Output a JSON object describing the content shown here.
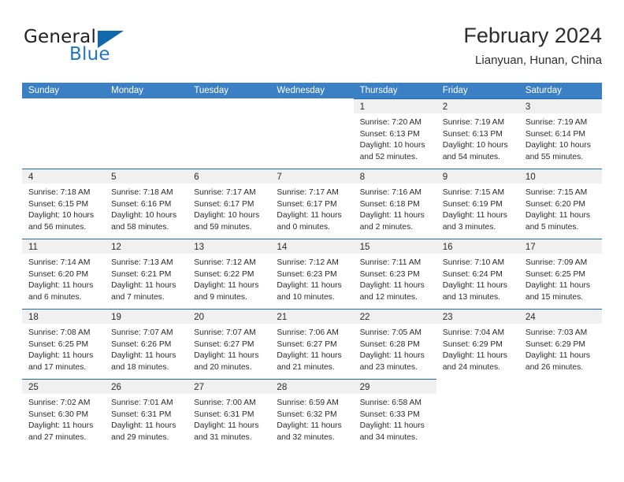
{
  "logo": {
    "word_top": "General",
    "word_bottom": "Blue",
    "flag_icon": "triangle-flag-icon",
    "color_blue": "#1f76c2",
    "color_dark": "#231f20"
  },
  "header": {
    "title": "February 2024",
    "subtitle": "Lianyuan, Hunan, China"
  },
  "calendar": {
    "header_bg": "#3b7fc4",
    "weekdays": [
      "Sunday",
      "Monday",
      "Tuesday",
      "Wednesday",
      "Thursday",
      "Friday",
      "Saturday"
    ],
    "weeks": [
      [
        {
          "day": "",
          "state": "empty",
          "lines": []
        },
        {
          "day": "",
          "state": "empty",
          "lines": []
        },
        {
          "day": "",
          "state": "empty",
          "lines": []
        },
        {
          "day": "",
          "state": "empty",
          "lines": []
        },
        {
          "day": "1",
          "state": "filled",
          "lines": [
            "Sunrise: 7:20 AM",
            "Sunset: 6:13 PM",
            "Daylight: 10 hours",
            "and 52 minutes."
          ]
        },
        {
          "day": "2",
          "state": "filled",
          "lines": [
            "Sunrise: 7:19 AM",
            "Sunset: 6:13 PM",
            "Daylight: 10 hours",
            "and 54 minutes."
          ]
        },
        {
          "day": "3",
          "state": "filled",
          "lines": [
            "Sunrise: 7:19 AM",
            "Sunset: 6:14 PM",
            "Daylight: 10 hours",
            "and 55 minutes."
          ]
        }
      ],
      [
        {
          "day": "4",
          "state": "filled",
          "lines": [
            "Sunrise: 7:18 AM",
            "Sunset: 6:15 PM",
            "Daylight: 10 hours",
            "and 56 minutes."
          ]
        },
        {
          "day": "5",
          "state": "filled",
          "lines": [
            "Sunrise: 7:18 AM",
            "Sunset: 6:16 PM",
            "Daylight: 10 hours",
            "and 58 minutes."
          ]
        },
        {
          "day": "6",
          "state": "filled",
          "lines": [
            "Sunrise: 7:17 AM",
            "Sunset: 6:17 PM",
            "Daylight: 10 hours",
            "and 59 minutes."
          ]
        },
        {
          "day": "7",
          "state": "filled",
          "lines": [
            "Sunrise: 7:17 AM",
            "Sunset: 6:17 PM",
            "Daylight: 11 hours",
            "and 0 minutes."
          ]
        },
        {
          "day": "8",
          "state": "filled",
          "lines": [
            "Sunrise: 7:16 AM",
            "Sunset: 6:18 PM",
            "Daylight: 11 hours",
            "and 2 minutes."
          ]
        },
        {
          "day": "9",
          "state": "filled",
          "lines": [
            "Sunrise: 7:15 AM",
            "Sunset: 6:19 PM",
            "Daylight: 11 hours",
            "and 3 minutes."
          ]
        },
        {
          "day": "10",
          "state": "filled",
          "lines": [
            "Sunrise: 7:15 AM",
            "Sunset: 6:20 PM",
            "Daylight: 11 hours",
            "and 5 minutes."
          ]
        }
      ],
      [
        {
          "day": "11",
          "state": "filled",
          "lines": [
            "Sunrise: 7:14 AM",
            "Sunset: 6:20 PM",
            "Daylight: 11 hours",
            "and 6 minutes."
          ]
        },
        {
          "day": "12",
          "state": "filled",
          "lines": [
            "Sunrise: 7:13 AM",
            "Sunset: 6:21 PM",
            "Daylight: 11 hours",
            "and 7 minutes."
          ]
        },
        {
          "day": "13",
          "state": "filled",
          "lines": [
            "Sunrise: 7:12 AM",
            "Sunset: 6:22 PM",
            "Daylight: 11 hours",
            "and 9 minutes."
          ]
        },
        {
          "day": "14",
          "state": "filled",
          "lines": [
            "Sunrise: 7:12 AM",
            "Sunset: 6:23 PM",
            "Daylight: 11 hours",
            "and 10 minutes."
          ]
        },
        {
          "day": "15",
          "state": "filled",
          "lines": [
            "Sunrise: 7:11 AM",
            "Sunset: 6:23 PM",
            "Daylight: 11 hours",
            "and 12 minutes."
          ]
        },
        {
          "day": "16",
          "state": "filled",
          "lines": [
            "Sunrise: 7:10 AM",
            "Sunset: 6:24 PM",
            "Daylight: 11 hours",
            "and 13 minutes."
          ]
        },
        {
          "day": "17",
          "state": "filled",
          "lines": [
            "Sunrise: 7:09 AM",
            "Sunset: 6:25 PM",
            "Daylight: 11 hours",
            "and 15 minutes."
          ]
        }
      ],
      [
        {
          "day": "18",
          "state": "filled",
          "lines": [
            "Sunrise: 7:08 AM",
            "Sunset: 6:25 PM",
            "Daylight: 11 hours",
            "and 17 minutes."
          ]
        },
        {
          "day": "19",
          "state": "filled",
          "lines": [
            "Sunrise: 7:07 AM",
            "Sunset: 6:26 PM",
            "Daylight: 11 hours",
            "and 18 minutes."
          ]
        },
        {
          "day": "20",
          "state": "filled",
          "lines": [
            "Sunrise: 7:07 AM",
            "Sunset: 6:27 PM",
            "Daylight: 11 hours",
            "and 20 minutes."
          ]
        },
        {
          "day": "21",
          "state": "filled",
          "lines": [
            "Sunrise: 7:06 AM",
            "Sunset: 6:27 PM",
            "Daylight: 11 hours",
            "and 21 minutes."
          ]
        },
        {
          "day": "22",
          "state": "filled",
          "lines": [
            "Sunrise: 7:05 AM",
            "Sunset: 6:28 PM",
            "Daylight: 11 hours",
            "and 23 minutes."
          ]
        },
        {
          "day": "23",
          "state": "filled",
          "lines": [
            "Sunrise: 7:04 AM",
            "Sunset: 6:29 PM",
            "Daylight: 11 hours",
            "and 24 minutes."
          ]
        },
        {
          "day": "24",
          "state": "filled",
          "lines": [
            "Sunrise: 7:03 AM",
            "Sunset: 6:29 PM",
            "Daylight: 11 hours",
            "and 26 minutes."
          ]
        }
      ],
      [
        {
          "day": "25",
          "state": "filled",
          "lines": [
            "Sunrise: 7:02 AM",
            "Sunset: 6:30 PM",
            "Daylight: 11 hours",
            "and 27 minutes."
          ]
        },
        {
          "day": "26",
          "state": "filled",
          "lines": [
            "Sunrise: 7:01 AM",
            "Sunset: 6:31 PM",
            "Daylight: 11 hours",
            "and 29 minutes."
          ]
        },
        {
          "day": "27",
          "state": "filled",
          "lines": [
            "Sunrise: 7:00 AM",
            "Sunset: 6:31 PM",
            "Daylight: 11 hours",
            "and 31 minutes."
          ]
        },
        {
          "day": "28",
          "state": "filled",
          "lines": [
            "Sunrise: 6:59 AM",
            "Sunset: 6:32 PM",
            "Daylight: 11 hours",
            "and 32 minutes."
          ]
        },
        {
          "day": "29",
          "state": "filled",
          "lines": [
            "Sunrise: 6:58 AM",
            "Sunset: 6:33 PM",
            "Daylight: 11 hours",
            "and 34 minutes."
          ]
        },
        {
          "day": "",
          "state": "empty",
          "lines": []
        },
        {
          "day": "",
          "state": "empty",
          "lines": []
        }
      ]
    ]
  }
}
